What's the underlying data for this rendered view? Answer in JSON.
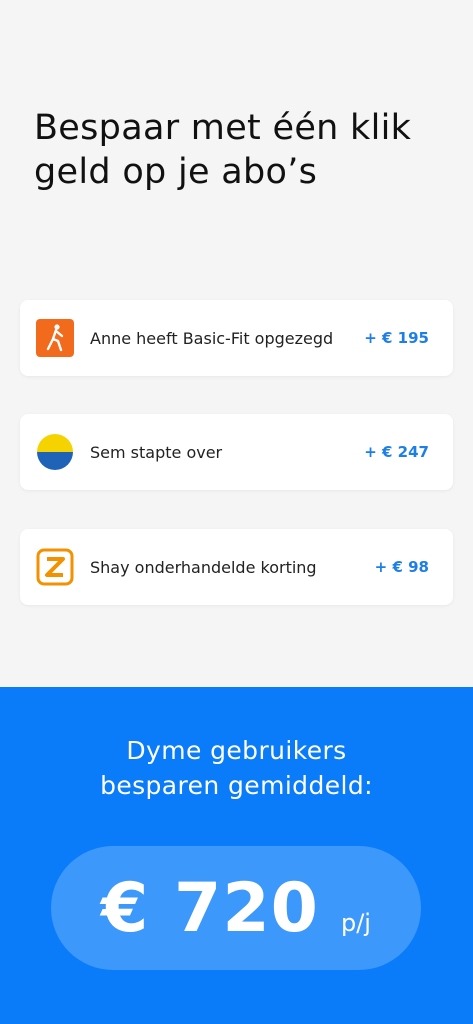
{
  "headline": {
    "line1": "Bespaar met één klik",
    "line2": "geld op je abo’s"
  },
  "cards": [
    {
      "text": "Anne heeft Basic-Fit opgezegd",
      "amount": "+ € 195",
      "logo_icon": "basic-fit-logo-icon",
      "logo_color": "#f26a1b"
    },
    {
      "text": "Sem stapte over",
      "amount": "+ € 247",
      "logo_icon": "yellow-blue-circle-logo-icon",
      "logo_color": "#f5d300"
    },
    {
      "text": "Shay onderhandelde korting",
      "amount": "+ € 98",
      "logo_icon": "ziggo-logo-icon",
      "logo_color": "#f39200"
    }
  ],
  "savings_panel": {
    "title_line1": "Dyme gebruikers",
    "title_line2": "besparen gemiddeld:",
    "amount": "€ 720",
    "unit": "p/j"
  },
  "colors": {
    "accent_blue": "#0b7cf9",
    "pill_blue": "#3d98fb",
    "amount_blue": "#1d7fe6"
  }
}
